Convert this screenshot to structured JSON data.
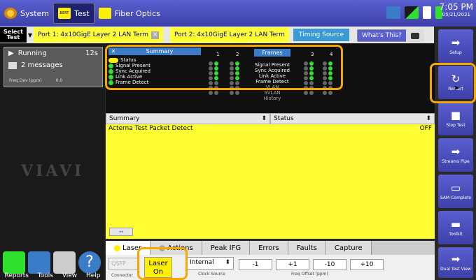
{
  "topbar": {
    "system_label": "System",
    "test_label": "Test",
    "test_icon_text": "BERT",
    "fiber_label": "Fiber Optics",
    "time": "7:05 PM",
    "date": "05/21/2021"
  },
  "portbar": {
    "select_test": "Select\nTest",
    "port1": "Port 1: 4x10GigE Layer 2 LAN Term",
    "port2": "Port 2: 4x10GigE Layer 2 LAN Term",
    "timing_source": "Timing Source",
    "whats_this": "What's This?"
  },
  "left": {
    "status": "Running",
    "elapsed": "12s",
    "messages": "2 messages",
    "freq_label": "Freq Dev (ppm)",
    "freq_value": "0.0",
    "logo": "VIAVI",
    "bottom_labels": [
      "Reports",
      "Tools",
      "View",
      "Help"
    ]
  },
  "leds": {
    "summary_title": "Summary",
    "legend": [
      "Status",
      "Signal Present",
      "Sync Acquired",
      "Link Active",
      "Frame Detect"
    ],
    "col_nums": [
      "1",
      "2",
      "3",
      "4"
    ],
    "frames_title": "Frames",
    "frames_labels": [
      "Signal Present",
      "Sync Acquired",
      "Link Active",
      "Frame Detect",
      "VLAN",
      "SVLAN",
      "History"
    ]
  },
  "table": {
    "col1": "Summary",
    "col2": "Status",
    "row_label": "Acterna Test Packet Detect",
    "row_value": "OFF"
  },
  "tabs": [
    "Laser",
    "Actions",
    "Peak IFG",
    "Errors",
    "Faults",
    "Capture"
  ],
  "controls": {
    "connector_value": "QSFP",
    "connector_label": "Connector",
    "laser_btn": "Laser\nOn",
    "clock_value": "Internal",
    "clock_label": "Clock Source",
    "freq_buttons": [
      "-1",
      "+1",
      "-10",
      "+10"
    ],
    "freq_label": "Freq Offset (ppm)"
  },
  "rightbar": [
    "Setup",
    "Restart",
    "Stop Test",
    "Streams Pipe",
    "SAM-Complete",
    "Toolkit",
    "Dual Test View"
  ],
  "colors": {
    "accent": "#5a5fd0",
    "highlight": "#ffff33",
    "led_green": "#2fe02f",
    "orange": "#f7a800"
  }
}
